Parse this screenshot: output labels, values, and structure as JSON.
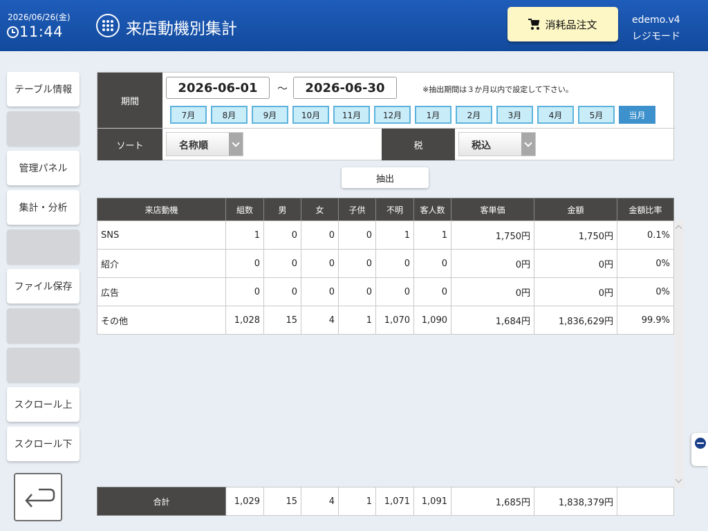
{
  "header": {
    "date": "2026/06/26(金)",
    "time": "11:44",
    "title": "来店動機別集計",
    "order_button": "消耗品注文",
    "user_line1": "edemo.v4",
    "user_line2": "レジモード"
  },
  "sidebar": {
    "items": [
      {
        "label": "テーブル情報"
      },
      {
        "label": ""
      },
      {
        "label": "管理パネル"
      },
      {
        "label": "集計・分析"
      },
      {
        "label": ""
      },
      {
        "label": "ファイル保存"
      },
      {
        "label": ""
      },
      {
        "label": ""
      },
      {
        "label": "スクロール上"
      },
      {
        "label": "スクロール下"
      }
    ]
  },
  "filter": {
    "period_label": "期間",
    "start_date": "2026-06-01",
    "separator": "～",
    "end_date": "2026-06-30",
    "note": "※抽出期間は３か月以内で設定して下さい。",
    "months": [
      "7月",
      "8月",
      "9月",
      "10月",
      "11月",
      "12月",
      "1月",
      "2月",
      "3月",
      "4月",
      "5月",
      "当月"
    ],
    "sort_label": "ソート",
    "sort_value": "名称順",
    "tax_label": "税",
    "tax_value": "税込"
  },
  "extract_button": "抽出",
  "table": {
    "headers": [
      "来店動機",
      "組数",
      "男",
      "女",
      "子供",
      "不明",
      "客人数",
      "客単価",
      "金額",
      "金額比率"
    ],
    "rows": [
      [
        "SNS",
        "1",
        "0",
        "0",
        "0",
        "1",
        "1",
        "1,750円",
        "1,750円",
        "0.1%"
      ],
      [
        "紹介",
        "0",
        "0",
        "0",
        "0",
        "0",
        "0",
        "0円",
        "0円",
        "0%"
      ],
      [
        "広告",
        "0",
        "0",
        "0",
        "0",
        "0",
        "0",
        "0円",
        "0円",
        "0%"
      ],
      [
        "その他",
        "1,028",
        "15",
        "4",
        "1",
        "1,070",
        "1,090",
        "1,684円",
        "1,836,629円",
        "99.9%"
      ]
    ],
    "total": [
      "合計",
      "1,029",
      "15",
      "4",
      "1",
      "1,071",
      "1,091",
      "1,685円",
      "1,838,379円",
      ""
    ]
  },
  "colors": {
    "header_bg": "#1f5dbb",
    "order_button_bg": "#fdf7c5",
    "table_header_bg": "#484746",
    "month_button_bg": "#c9ecf9",
    "month_button_active": "#3d91cc"
  }
}
